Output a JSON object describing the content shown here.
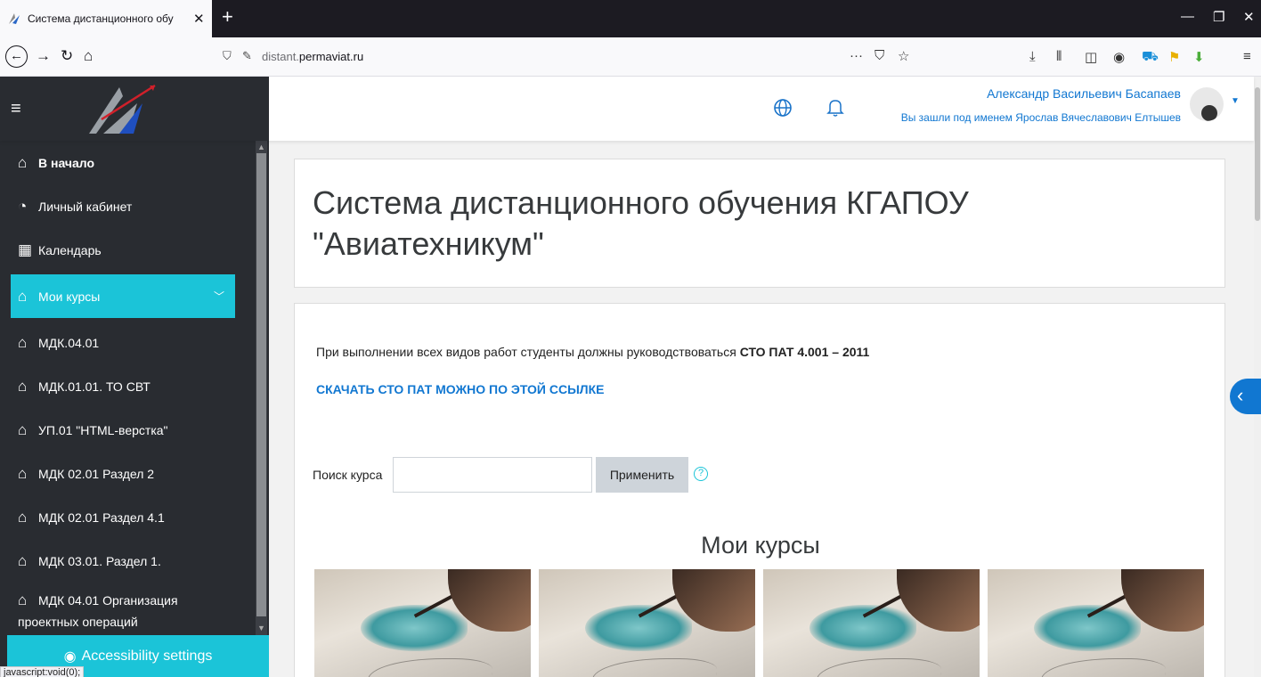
{
  "browser": {
    "tab_title": "Система дистанционного обу",
    "url_domain": "distant.",
    "url_host": "permaviat.ru",
    "status_text": "javascript:void(0);"
  },
  "header": {
    "user_name": "Александр Васильевич Басапаев",
    "logged_in_as": "Вы зашли под именем Ярослав Вячеславович Елтышев"
  },
  "sidebar": {
    "items": [
      {
        "label": "В начало",
        "icon": "home-icon"
      },
      {
        "label": "Личный кабинет",
        "icon": "dashboard-icon"
      },
      {
        "label": "Календарь",
        "icon": "calendar-icon"
      },
      {
        "label": "Мои курсы",
        "icon": "graduation-cap-icon"
      },
      {
        "label": "МДК.04.01",
        "icon": "graduation-cap-icon"
      },
      {
        "label": "МДК.01.01. ТО СВТ",
        "icon": "graduation-cap-icon"
      },
      {
        "label": "УП.01 \"HTML-верстка\"",
        "icon": "graduation-cap-icon"
      },
      {
        "label": "МДК 02.01 Раздел 2",
        "icon": "graduation-cap-icon"
      },
      {
        "label": "МДК 02.01 Раздел 4.1",
        "icon": "graduation-cap-icon"
      },
      {
        "label": "МДК 03.01. Раздел 1.",
        "icon": "graduation-cap-icon"
      },
      {
        "label": "МДК 04.01 Организация",
        "label2": "проектных операций",
        "icon": "graduation-cap-icon"
      }
    ],
    "accessibility": "Accessibility settings"
  },
  "main": {
    "title": "Система дистанционного обучения КГАПОУ \"Авиатехникум\"",
    "notice_prefix": "При выполнении всех видов работ студенты должны руководствоваться ",
    "notice_bold": "СТО ПАТ 4.001 – 2011",
    "download_link": "СКАЧАТЬ СТО ПАТ МОЖНО ПО ЭТОЙ ССЫЛКЕ",
    "search_label": "Поиск курса",
    "search_value": "",
    "apply_button": "Применить",
    "my_courses_title": "Мои курсы"
  },
  "colors": {
    "sidebar_bg": "#292c31",
    "accent_teal": "#1bc4d8",
    "link_blue": "#1177d1"
  }
}
